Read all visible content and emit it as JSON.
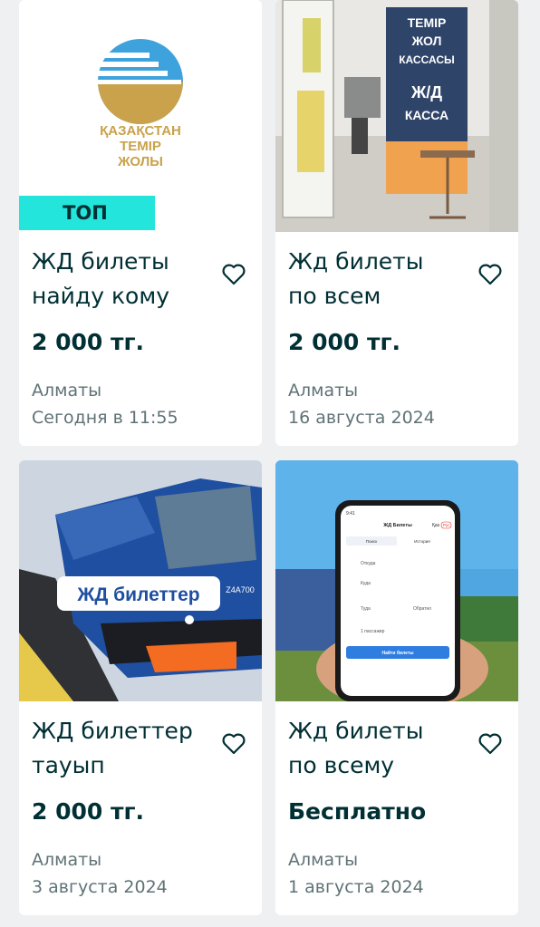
{
  "listings": [
    {
      "badge": "ТОП",
      "title_line1": "ЖД билеты",
      "title_line2": "найду кому",
      "price": "2 000 тг.",
      "location": "Алматы",
      "date": "Сегодня в 11:55",
      "logo_text": [
        "ҚАЗАҚСТАН",
        "ТЕМІР",
        "ЖОЛЫ"
      ]
    },
    {
      "title_line1": "Жд билеты",
      "title_line2": "по всем",
      "price": "2 000 тг.",
      "location": "Алматы",
      "date": "16 августа 2024",
      "sign_text": [
        "ТЕМІР",
        "ЖОЛ",
        "КАССАСЫ",
        "Ж/Д",
        "КАССА"
      ]
    },
    {
      "title_line1": "ЖД билеттер",
      "title_line2": "тауып",
      "price": "2 000 тг.",
      "location": "Алматы",
      "date": "3 августа 2024",
      "overlay_text": "ЖД билеттер",
      "loco_number": "Z4A700"
    },
    {
      "title_line1": "Жд билеты",
      "title_line2": "по всему",
      "price": "Бесплатно",
      "location": "Алматы",
      "date": "1 августа 2024",
      "phone": {
        "time": "9:41",
        "header": "ЖД Билеты",
        "lang1": "Қаз",
        "lang2": "Рус",
        "tab1": "Поиск",
        "tab2": "История",
        "from": "Откуда",
        "to": "Куда",
        "there": "Туда",
        "back": "Обратно",
        "passengers": "1 пассажир",
        "button": "Найти билеты"
      }
    }
  ],
  "colors": {
    "badge": "#23e5db",
    "text_dark": "#002f34",
    "text_muted": "#5f7276",
    "background": "#eef0f2"
  }
}
